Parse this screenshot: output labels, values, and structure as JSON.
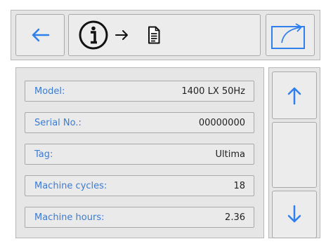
{
  "header": {
    "back_icon": "arrow-left-icon",
    "info_icon": "info-circle-icon",
    "info_arrow_icon": "arrow-right-icon",
    "document_icon": "document-icon",
    "export_icon": "export-icon"
  },
  "details": [
    {
      "label": "Model:",
      "value": "1400 LX 50Hz"
    },
    {
      "label": "Serial No.:",
      "value": "00000000"
    },
    {
      "label": "Tag:",
      "value": "Ultima"
    },
    {
      "label": "Machine cycles:",
      "value": "18"
    },
    {
      "label": "Machine hours:",
      "value": "2.36"
    }
  ],
  "scroll": {
    "up_icon": "arrow-up-icon",
    "down_icon": "arrow-down-icon"
  },
  "colors": {
    "accent": "#2f80ed",
    "label": "#3a7bd5",
    "panel": "#e6e6e6"
  }
}
